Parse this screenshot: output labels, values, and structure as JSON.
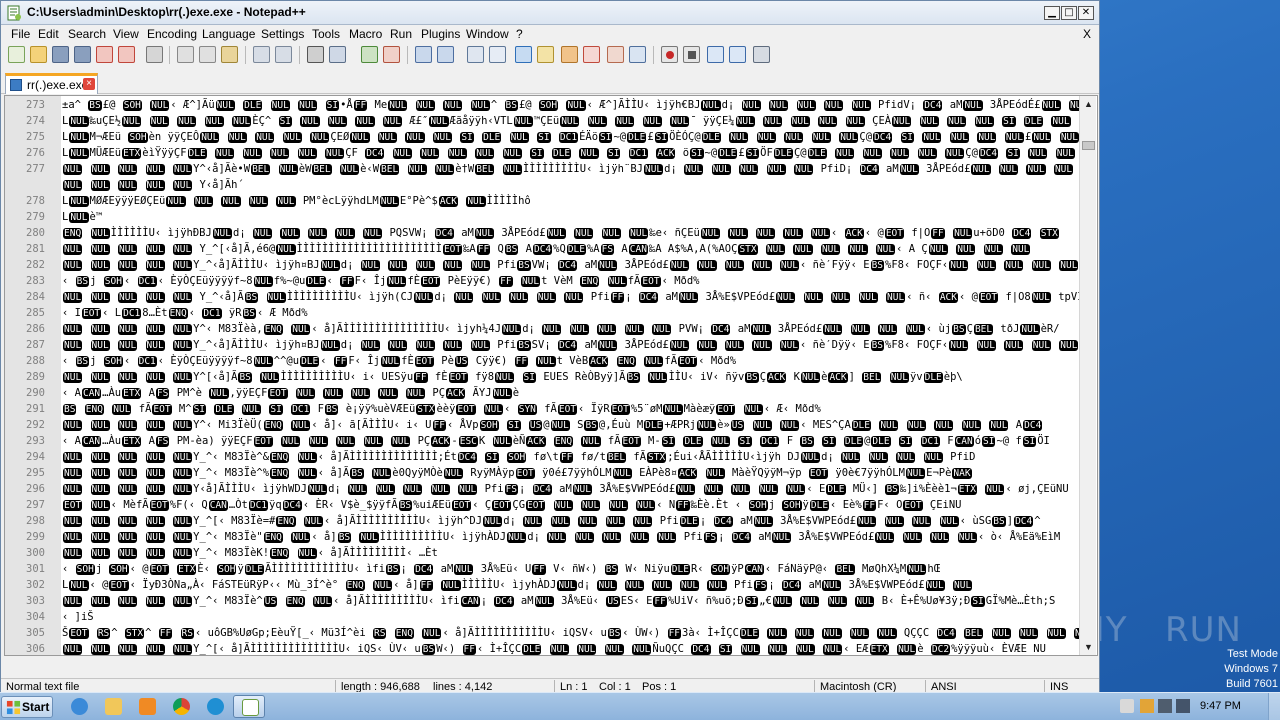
{
  "window": {
    "title": "C:\\Users\\admin\\Desktop\\rr(.)exe.exe - Notepad++",
    "minimize": "▁",
    "maximize": "□",
    "close": "✕"
  },
  "menubar": {
    "items": [
      "File",
      "Edit",
      "Search",
      "View",
      "Encoding",
      "Language",
      "Settings",
      "Tools",
      "Macro",
      "Run",
      "Plugins",
      "Window",
      "?"
    ],
    "close_doc": "X"
  },
  "toolbar": {
    "icons": [
      "new-file-icon",
      "open-file-icon",
      "save-icon",
      "save-all-icon",
      "close-icon",
      "close-all-icon",
      "print-icon",
      "cut-icon",
      "copy-icon",
      "paste-icon",
      "undo-icon",
      "redo-icon",
      "find-icon",
      "replace-icon",
      "zoom-in-icon",
      "zoom-out-icon",
      "sync-vertical-icon",
      "sync-horizontal-icon",
      "word-wrap-icon",
      "show-all-chars-icon",
      "indent-guide-icon",
      "doc-map-icon",
      "function-list-icon",
      "folder-workspace-icon",
      "monitoring-icon",
      "record-macro-icon",
      "stop-macro-icon",
      "play-macro-icon",
      "run-macro-multiple-icon",
      "save-macro-icon"
    ]
  },
  "tab": {
    "label": "rr(.)exe.exe",
    "close": "×"
  },
  "editor": {
    "lines": [
      {
        "n": "273",
        "t": "±a^ BS£@ SOH NUL‹ Æ^]ÃüNUL DLE NUL NUL SI•ÅFF MeNUL NUL NUL NUL^ BS£@ SOH NUL‹ Æ^]ÃÌÌU‹ ìjÿh€BJNULd¡ NUL NUL NUL NUL NUL PfidV¡ DC4 aMNUL 3ÅPEódÉ£NUL NUL"
      },
      {
        "n": "274",
        "t": "LNUL‰uÇE½NUL NUL NUL NUL NULÈÇ^ SI NUL NUL NUL NUL Æ£″NULÆãåÿÿh‹VTLNUL™ÇEüNUL NUL NUL NUL NUL¯ ÿÿÇE¼NUL NUL NUL NUL NUL ÇEÀNUL NUL NUL NUL SI DLE NUL SI SI"
      },
      {
        "n": "275",
        "t": "LNULM¬ÆEü SOHèn ÿÿÇEÔNUL NUL NUL NUL NULÇEØNUL NUL NUL NUL SI DLE NUL SI DC1ÉÄöSI~@DLE£SIÖÈÓÇ@DLE NUL NUL NUL NUL NULÇ@DC4 SI NUL NUL NUL NUL£NUL NUL"
      },
      {
        "n": "276",
        "t": "LNULMÜÆEüETXèìŸÿÿÇFDLE NUL NUL NUL NUL NULÇF DC4 NUL NUL NUL NUL NUL SI DLE NUL SI DC1 ACK öSI~@DLE£SIÖFDLEÇ@DLE NUL NUL NUL NUL NULÇ@DC4 SI NUL NUL NUL"
      },
      {
        "n": "277",
        "t": "NUL NUL NUL NUL NULY^‹å]Ãè•WBEL NULèWBEL NULè‹WBEL NUL NULè†WBEL NULÌÌÌÌÌÌÌÌÌU‹ ìjÿh¨BJNULd¡ NUL NUL NUL NUL NUL PfiD¡ DC4 aMNUL 3ÅPEód£NUL NUL NUL NUL"
      },
      {
        "n": "",
        "t": "NUL NUL NUL NUL NUL Y‹å]Ãh´"
      },
      {
        "n": "278",
        "t": "LNULMØÆEÿÿÿEØÇEüNUL NUL NUL NUL NUL PM°ècLÿÿhdLMNULE°Pè^$ACK NULÌÌÌÌÌhô"
      },
      {
        "n": "279",
        "t": "LNULè™"
      },
      {
        "n": "280",
        "t": "ENQ NULÌÌÌÌÌÌU‹ ìjÿhÐBJNULd¡ NUL NUL NUL NUL NUL PQSVW¡ DC4 aMNUL 3ÅPEód£NUL NUL NUL NUL‰e‹ ñÇEüNUL NUL NUL NUL NUL‹ ACK‹ @EOT f|OFF NULu+öD0 DC4 STX"
      },
      {
        "n": "281",
        "t": "NUL NUL NUL NUL NUL Y_^[‹å]Ã,é6@NULÌÌÌÌÌÌÌÌÌÌÌÌÌÌÌÌÌÌÌÌÌÌÌEOT‰AFF QBS ADC4%QDLE%AFS ACAN‰A A$%A,A(%AOÇSTX NUL NUL NUL NUL NUL‹ A ÇNUL NUL NUL NUL"
      },
      {
        "n": "282",
        "t": "NUL NUL NUL NUL NULY_^‹å]ÃÌÌÌU‹ ìjÿh¤BJNULd¡ NUL NUL NUL NUL NUL PfiBSVW¡ DC4 aMNUL 3ÅPEód£NUL NUL NUL NUL NUL‹ ñè′Fÿÿ‹ EBS%F8‹ FOÇF‹NUL NUL NUL NUL NULÇEüNUL"
      },
      {
        "n": "283",
        "t": "‹ BSj SOH‹ DC1‹ ÈÿÒÇEüÿÿÿÿf~8NULf%~@uDLE‹ FFF‹ ÎjNULfÈEOT PèEÿÿ€) FF NULt   VèM ENQ NULfÃEOT‹ Mðd%"
      },
      {
        "n": "284",
        "t": "NUL NUL NUL NUL NUL Y_^‹å]ÃBS NULÌÌÌÌÌÌÌÌÌÌU‹ ìjÿh(CJNULd¡ NUL NUL NUL NUL NUL PfiFF¡ DC4 aMNUL 3Å%E$VPEód£NUL NUL NUL NUL NUL‹ ñ‹ ACK‹ @EOT f|O8NUL tpVI"
      },
      {
        "n": "285",
        "t": "‹ IEOT‹ LDC18…ÈtENQ‹ DC1 ÿRBS‹ Æ Mðd%"
      },
      {
        "n": "286",
        "t": "NUL NUL NUL NUL NULY^‹ M83Ïèà,ENQ NUL‹ å]ÃÌÌÌÌÌÌÌÌÌÌÌÌÌÌÌU‹ ìjyh¼4JNULd¡ NUL NUL NUL NUL NUL PVW¡ DC4 aMNUL 3ÅPEód£NUL NUL NUL NUL‹ ùjBSÇBEL tðJNULèR/"
      },
      {
        "n": "287",
        "t": "NUL NUL NUL NUL NULY_^‹å]ÃÌÌÌU‹ ìjÿh¤BJNULd¡ NUL NUL NUL NUL NUL PfiBSSV¡ DC4 aMNUL 3ÅPEód£NUL NUL NUL NUL NUL‹ ñè′Dÿÿ‹ EBS%F8‹ FOÇF‹NUL NUL NUL NUL NULÇEüNUL"
      },
      {
        "n": "288",
        "t": "‹ BSj SOH‹ DC1‹ ÈÿÒÇEüÿÿÿÿf~8NUL^^@uDLE‹ FFF‹ ÎjNULfÈEOT PèUS Cÿÿ€) FF NULt   VèBACK ENQ NULfÃEOT‹ Mðd%"
      },
      {
        "n": "289",
        "t": "NUL NUL NUL NUL NULY^[‹å]ÃBS NULÌÌÌÌÌÌÌÌÌÌU‹ i‹ UESÿuFF fÈEOT fÿ8NUL SI EUES RèÒByÿ]ÃBS NULÌÌU‹ iV‹ ñÿvBSÇACK  KNULèACK] BEL NULÿvDLEèþ\\"
      },
      {
        "n": "290",
        "t": "‹ ACAN…ÀuETX AFS PM^è NUL,ÿÿEÇFEOT NUL NUL NUL NUL NUL PÇACK ÃYJNULè"
      },
      {
        "n": "291",
        "t": "BS ENQ NUL fÃEOT M^SI DLE NUL SI DC1 FBS è¡ÿÿ%uèVÆEüSTXèèÿEOT NUL‹ SYN fÃEOT‹ ÏÿREOT%5¨øMNULMàèæÿEOT NUL‹ Æ‹ Mðd%"
      },
      {
        "n": "292",
        "t": "NUL NUL NUL NUL NULY^‹ Mi3ÏèÜ(ENQ NUL‹ å]‹ ã[ÃÌÌÌU‹ i‹ UFF‹ ÅVpSOH SI US@NUL SBS@,Éuù MDLE+ÆPRjNULè»US NUL NUL‹ MES^ÇADLE NUL NUL NUL NUL NUL ADC4"
      },
      {
        "n": "293",
        "t": "‹ ACAN…ÀuETX AFS PM-èa) ÿÿEÇFEOT NUL NUL NUL NUL NUL PÇACK-ESCK NULèÑACK ENQ NUL fÃEOT M-SI DLE NUL SI DC1 F BS SI DLE@DLE SI DC1 FCANóSI~@ fSIÖI"
      },
      {
        "n": "294",
        "t": "NUL NUL NUL NUL NULY_^‹ M83Ïè^&ENQ NUL‹ å]ÃÌÌÌÌÌÌÌÌÌÌÌÌÌÌ;ÉtDC4 SI SOH fø\\tFF fø/tBEL fÃSTX;Éui‹ÅÃÌÌÌÌÌU‹ìjÿh   DJNULd¡ NUL NUL NUL NUL PfiD"
      },
      {
        "n": "295",
        "t": "NUL NUL NUL NUL NULY_^‹ M83Ïè^%ENQ NUL‹ å]ÃBS NULè0QyÿMÒèNUL RyÿMÀÿpEOT ÿ0é£7ÿÿhÓLMNUL EÀPè8¤ACK NUL MàèŸQÿÿM¬ÿp EOT ÿ0è€7ÿÿhÓLMNULE¬PèNAK"
      },
      {
        "n": "296",
        "t": "NUL NUL NUL NUL NULY‹å]ÃÌÌÌU‹ ìjÿhWDJNULd¡ NUL NUL NUL NUL NUL PfiFS¡ DC4 aMNUL 3Å%E$VWPEód£NUL NUL NUL NUL NUL‹ EDLE MÜ‹] BS‰]i%Èèè1¬ETX NUL‹ øj,ÇEüNU"
      },
      {
        "n": "297",
        "t": "EOT NUL‹ MèfÃEOT%F(‹ QCAN…ÒtDC1ÿqDC4‹ ÈR‹ V$è_$ÿÿfÃBS%uiÆEüEOT‹ ÇEOTÇGEOT NUL NUL NUL NUL‹ NFF‰Èè.Èt  ‹ SOHj SOHÿDLE‹ Eè%FFF‹ OEOT ÇEiNU"
      },
      {
        "n": "298",
        "t": "NUL NUL NUL NUL NULY_^[‹ M83Ïè=#ENQ NUL‹ å]ÃÌÌÌÌÌÌÌÌÌÌU‹ ìjÿh^DJNULd¡ NUL NUL NUL NUL NUL PfiDLE¡ DC4 aMNUL 3Å%E$VWPEód£NUL NUL NUL NUL‹ ùSGBS]DC4^"
      },
      {
        "n": "299",
        "t": "NUL NUL NUL NUL NULY_^‹ M83Ïè\"ENQ NUL‹ å]BS NULÌÌÌÌÌÌÌÌÌÌU‹ ìjÿhÀDJNULd¡ NUL NUL NUL NUL NUL PfiFS¡ DC4 aMNUL 3Å%E$VWPEód£NUL NUL NUL NUL‹ ò‹ Å%Eä%EìM"
      },
      {
        "n": "300",
        "t": "NUL NUL NUL NUL NULY_^‹ M83ÏèK!ENQ NUL‹ å]ÃÌÌÌÌÌÌÌÌÌ‹    …Èt"
      },
      {
        "n": "301",
        "t": "‹ SOHj SOH‹ @EOT ETXÈ‹ SOHÿDLEÃÌÌÌÌÌÌÌÌÌÌÌÌU‹ ìfiBS¡ DC4 aMNUL 3Å%Eü‹ UFF V‹ ñW‹) BS W‹ NiÿuDLER‹ SOHÿPCAN‹ FáNäÿP@‹ BEL MøQhX¼MNULhŒ"
      },
      {
        "n": "302",
        "t": "LNUL‹ @EOT‹ ÏyÐ3ÒNa„À‹ FáSTEüRÿP‹‹ Mù_3Í^è°  ENQ NUL‹ å]FF NULÌÌÌÌÌU‹ ìjyhÀDJNULd¡ NUL NUL NUL NUL NUL PfiFS¡ DC4 aMNUL 3Å%E$VWPEód£NUL NUL"
      },
      {
        "n": "303",
        "t": "NUL NUL NUL NUL NULY_^‹ M83Ïè^US ENQ NUL‹ å]ÃÌÌÌÌÌÌÌÌÌU‹ ìfiCAN¡ DC4 aMNUL 3Å%Eü‹ USES‹ EFF%UiV‹ ñ%uö;ÐSI„€NUL NUL NUL NUL B‹ È+Ê%Uø¥3ÿ;ÐSIGÏ%Mè…Èth;S"
      },
      {
        "n": "304",
        "t": "‹ ]iŠ"
      },
      {
        "n": "305",
        "t": "ŠEOT RS^ STX^ FF RS‹ uôGB%UøGp;EèuŸ[_‹ Mü3Í^èi RS ENQ NUL‹ å]ÃÌÌÌÌÌÌÌÌÌÌÌU‹ iQSV‹ uBS‹ ÙW‹) FF3à‹ Ì+ÎÇCDLE NUL NUL NUL NUL NUL QÇÇC DC4 BEL NUL NUL NUL NUL"
      },
      {
        "n": "306",
        "t": "NUL NUL NUL NUL NULY_^[‹ å]ÃÌÌÌÌÌÌÌÌÌÌÌÌÌÌU‹ iQS‹ ÙV‹ uBSW‹) FF‹ Ì+ÎÇCDLE NUL NUL NUL NULÑuQÇC DC4 SI NUL NUL NUL NUL‹ EÆETX NULè DC2%ÿÿÿuù‹ ÈVÆE NU"
      }
    ]
  },
  "status": {
    "file_type": "Normal text file",
    "length": "length : 946,688",
    "lines": "lines : 4,142",
    "ln": "Ln : 1",
    "col": "Col : 1",
    "pos": "Pos : 1",
    "eol": "Macintosh (CR)",
    "encoding": "ANSI",
    "mode": "INS"
  },
  "desktop": {
    "watermark_left": "ANY",
    "watermark_right": "RUN",
    "test_mode": "Test Mode",
    "os_name": "Windows 7",
    "build": "Build 7601"
  },
  "taskbar": {
    "start_label": "Start",
    "clock": "9:47 PM",
    "apps": [
      "ie-icon",
      "explorer-icon",
      "media-player-icon",
      "chrome-icon",
      "edge-icon",
      "notepad-plus-plus-icon"
    ],
    "tray_icons": [
      "action-center-icon",
      "network-icon",
      "volume-icon",
      "shield-icon"
    ]
  },
  "colors": {
    "accent_tab": "#f5a623",
    "taskbar": "#8db3dc",
    "desktop": "#2a6fc0"
  }
}
